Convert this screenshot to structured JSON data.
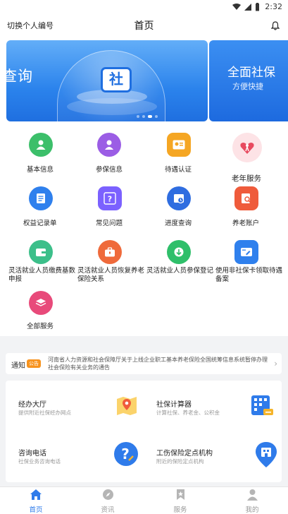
{
  "status_bar": {
    "time": "2:32"
  },
  "header": {
    "switch_label": "切换个人编号",
    "title": "首页"
  },
  "banner": {
    "main_text": "查询",
    "logo_char": "社",
    "next_title": "全面社保",
    "next_subtitle": "方便快捷",
    "colors": {
      "primary": "#2b83ec"
    }
  },
  "services_grid": [
    {
      "label": "基本信息",
      "icon": "user-card-icon",
      "color": "#3cbf6a"
    },
    {
      "label": "参保信息",
      "icon": "person-icon",
      "color": "#9b5de5"
    },
    {
      "label": "待遇认证",
      "icon": "id-card-icon",
      "color": "#f5a623"
    },
    {
      "label": "老年服务",
      "icon": "elderly-icon",
      "color": "#e84a5f"
    },
    {
      "label": "权益记录单",
      "icon": "document-icon",
      "color": "#2f80ed"
    },
    {
      "label": "常见问题",
      "icon": "question-icon",
      "color": "#7b61ff"
    },
    {
      "label": "进度查询",
      "icon": "progress-icon",
      "color": "#2f6de0"
    },
    {
      "label": "养老账户",
      "icon": "account-search-icon",
      "color": "#ef5b3b"
    },
    {
      "label": "灵活就业人员缴费基数申报",
      "icon": "wallet-icon",
      "color": "#3cbf8a"
    },
    {
      "label": "灵活就业人员恢复养老保险关系",
      "icon": "briefcase-icon",
      "color": "#ef6a3b"
    },
    {
      "label": "灵活就业人员参保登记",
      "icon": "download-icon",
      "color": "#2fbf6a"
    },
    {
      "label": "使用非社保卡领取待遇备案",
      "icon": "card-edit-icon",
      "color": "#2f80ed"
    },
    {
      "label": "全部服务",
      "icon": "layers-icon",
      "color": "#e84a7a"
    }
  ],
  "notice": {
    "label": "通知",
    "badge": "公告",
    "text": "河南省人力资源和社会保障厅关于上线企业职工基本养老保险全国统筹信息系统暂停办理社会保险有关业务的通告"
  },
  "service_cards": [
    {
      "title": "经办大厅",
      "subtitle": "提供附近社保经办网点",
      "icon": "map-pin-icon"
    },
    {
      "title": "社保计算器",
      "subtitle": "计算社保、养老金、公积金",
      "icon": "calculator-icon"
    },
    {
      "title": "咨询电话",
      "subtitle": "社保业务咨询电话",
      "icon": "help-phone-icon"
    },
    {
      "title": "工伤保险定点机构",
      "subtitle": "附近的保险定点机构",
      "icon": "hospital-icon"
    }
  ],
  "tabs": [
    {
      "label": "首页",
      "active": true
    },
    {
      "label": "资讯",
      "active": false
    },
    {
      "label": "服务",
      "active": false
    },
    {
      "label": "我的",
      "active": false
    }
  ]
}
